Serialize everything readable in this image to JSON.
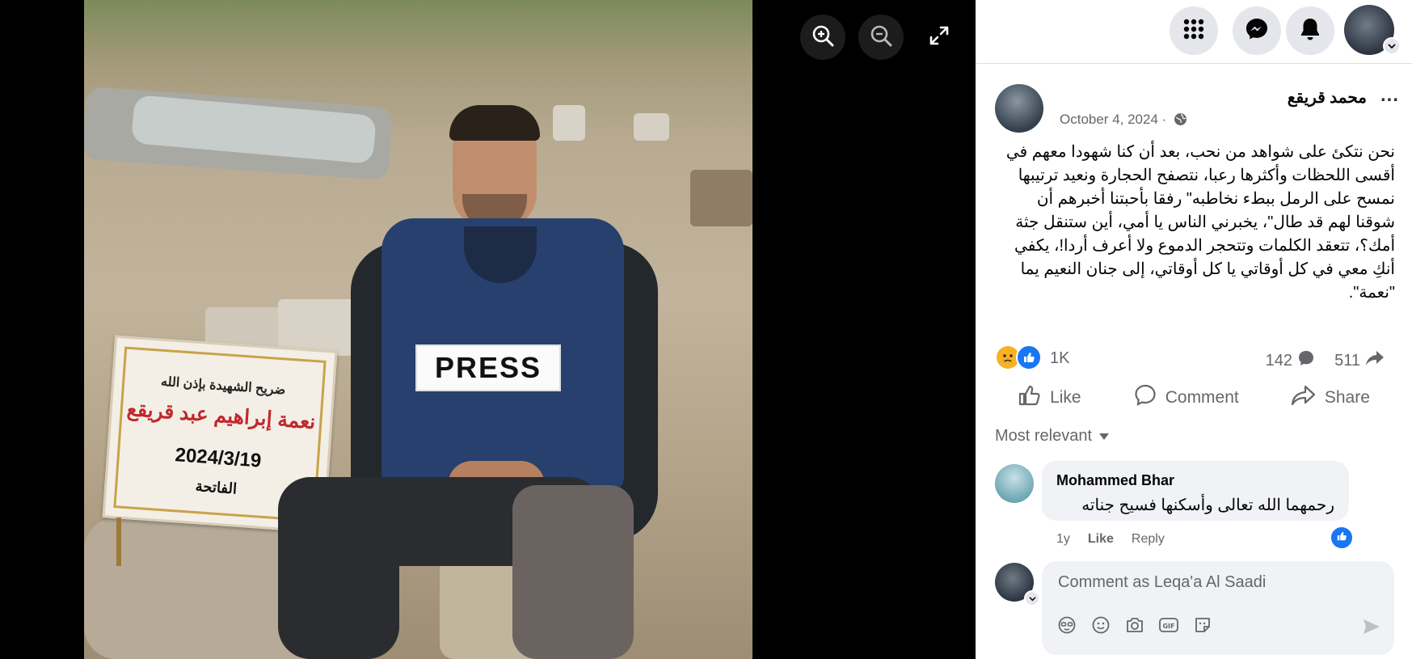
{
  "viewer": {
    "photo": {
      "vest_label": "PRESS",
      "sign": {
        "line1": "ضريح الشهيدة بإذن الله",
        "line2": "نعمة إبراهيم عبد قريقع",
        "line3": "2024/3/19",
        "line4": "الفاتحة"
      }
    },
    "controls": [
      "zoom-in-icon",
      "zoom-out-icon",
      "fullscreen-icon"
    ]
  },
  "topbar": {
    "icons": [
      "menu-grid-icon",
      "messenger-icon",
      "bell-icon",
      "chevron-down-icon"
    ]
  },
  "post": {
    "author": "محمد قريقع",
    "more": "...",
    "date": "October 4, 2024 ·",
    "privacy_icon": "globe-icon",
    "text": "نحن نتكئ على شواهد من نحب، بعد أن كنا شهودا معهم في أقسى اللحظات وأكثرها رعبا، نتصفح الحجارة ونعيد ترتيبها نمسح على الرمل ببطء نخاطبه\" رفقا بأحبتنا أخبرهم أن شوقنا لهم قد طال\"، يخبرني الناس يا أمي، أين ستنقل جثة أمك؟، تتعقد الكلمات وتتحجر الدموع ولا أعرف أردا!، يكفي أنكِ معي في كل أوقاتي يا كل أوقاتي، إلى جنان النعيم يما \"نعمة\".",
    "reactions": {
      "count": "1K",
      "icons": [
        "sad-reaction-icon",
        "like-reaction-icon"
      ],
      "comments": "142",
      "shares": "511"
    },
    "actions": {
      "like": "Like",
      "comment": "Comment",
      "share": "Share"
    },
    "sort_label": "Most relevant"
  },
  "comments": [
    {
      "author": "Mohammed Bhar",
      "text": "رحمهما الله تعالى وأسكنها فسيح جناته",
      "age": "1y",
      "like": "Like",
      "reply": "Reply"
    }
  ],
  "composer": {
    "placeholder": "Comment as Leqa'a Al Saadi",
    "tools": [
      "avatar-sticker-icon",
      "emoji-icon",
      "camera-icon",
      "gif-icon",
      "sticker-icon"
    ]
  },
  "colors": {
    "accent": "#1877f2",
    "secondary_text": "#65676b",
    "sign_red": "#c0282d"
  }
}
